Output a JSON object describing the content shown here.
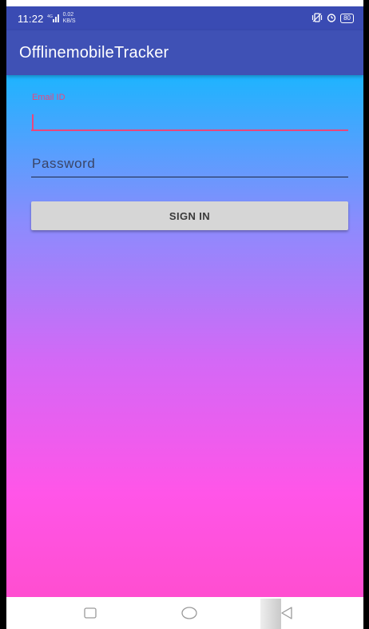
{
  "status_bar": {
    "time": "11:22",
    "network": "4G",
    "speed_top": "0.02",
    "speed_bottom": "KB/S",
    "battery": "80",
    "icons": [
      "signal-icon",
      "vibrate-icon",
      "alarm-icon",
      "battery-icon"
    ]
  },
  "app_bar": {
    "title": "OfflinemobileTracker"
  },
  "form": {
    "email_label": "Email ID",
    "email_value": "",
    "password_placeholder": "Password",
    "signin_label": "SIGN IN"
  },
  "nav_bar": {
    "icons": [
      "recents-square-icon",
      "home-circle-icon",
      "back-triangle-icon"
    ]
  },
  "colors": {
    "app_bar": "#3f51b5",
    "status_bar": "#3a4bb3",
    "accent": "#e8477d",
    "gradient_top": "#1eb4fe",
    "gradient_bottom": "#ff4ed0",
    "button": "#d6d6d6"
  }
}
